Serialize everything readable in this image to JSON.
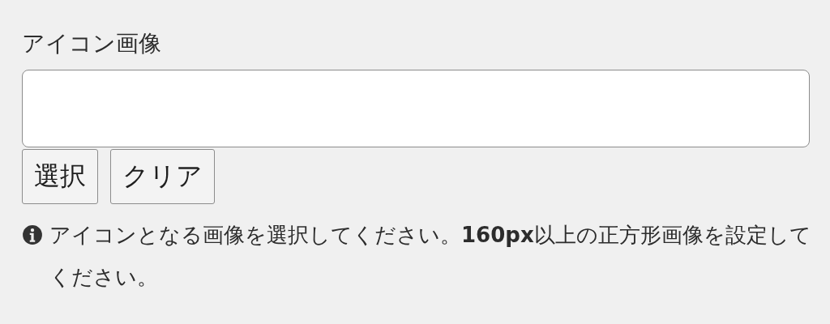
{
  "field": {
    "label": "アイコン画像"
  },
  "buttons": [
    "選択",
    "クリア"
  ],
  "help": "アイコンとなる画像を選択してください。**160px**以上の正方形画像を設定してください。"
}
